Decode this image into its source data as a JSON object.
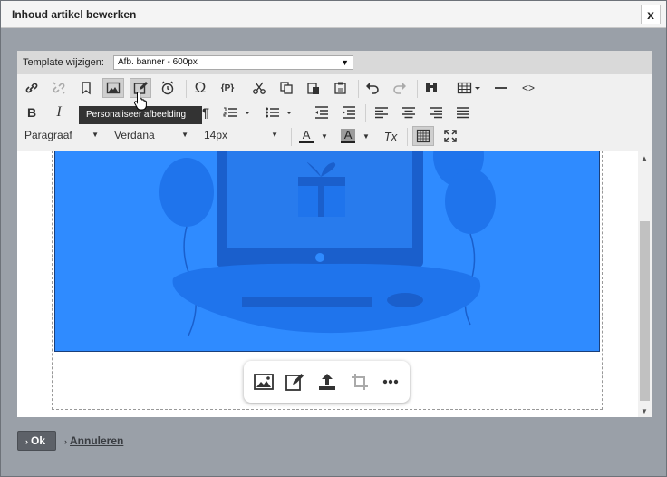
{
  "dialog": {
    "title": "Inhoud artikel bewerken",
    "close_label": "x"
  },
  "template": {
    "label": "Template wijzigen:",
    "value": "Afb. banner - 600px"
  },
  "toolbar": {
    "format_value": "Paragraaf",
    "font_value": "Verdana",
    "size_value": "14px",
    "omega": "Ω",
    "placeholder_label": "{P}",
    "bold": "B",
    "italic": "I",
    "text_color_letter": "A",
    "bg_color_letter": "A",
    "clear_format": "Tx",
    "code_label": "<>"
  },
  "tooltip": {
    "text": "Personaliseer afbeelding"
  },
  "footer": {
    "ok_label": "Ok",
    "cancel_label": "Annuleren"
  },
  "colors": {
    "banner": "#2f8bff",
    "banner_dark": "#1e6ce6",
    "dialog_bg": "#9aa0a8"
  }
}
